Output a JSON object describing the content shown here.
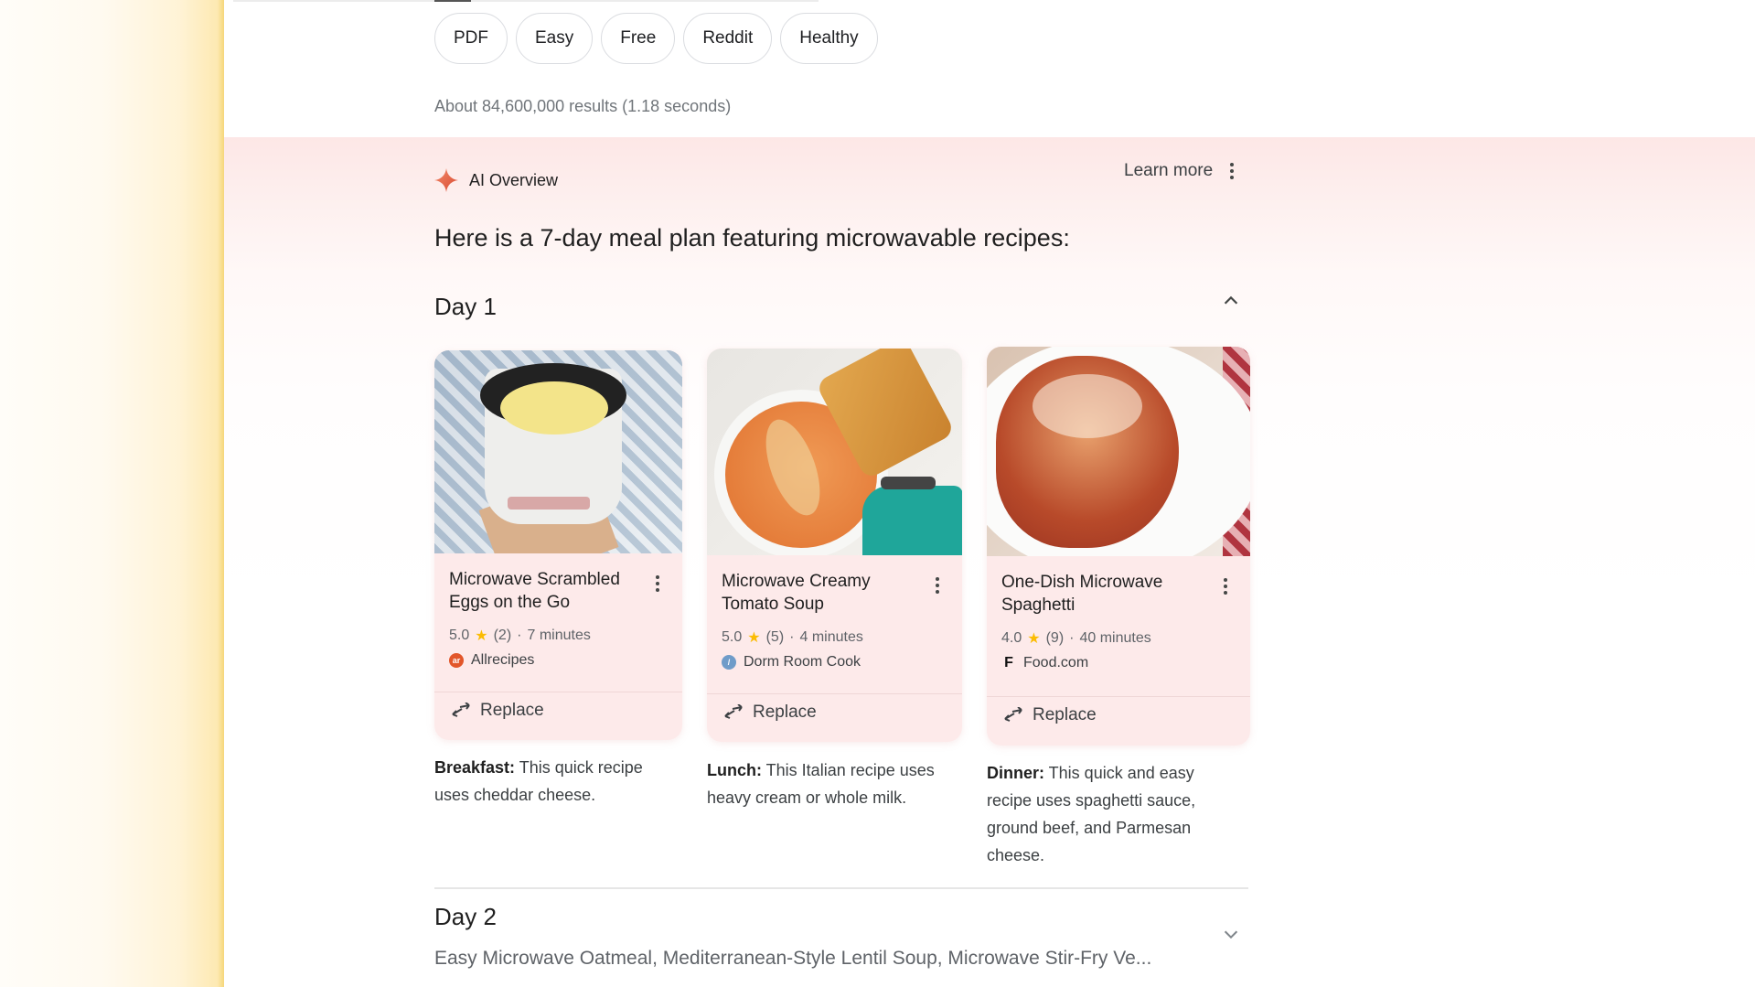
{
  "filter_chips": [
    "PDF",
    "Easy",
    "Free",
    "Reddit",
    "Healthy"
  ],
  "results_stats": "About 84,600,000 results (1.18 seconds)",
  "ai_overview": {
    "title": "AI Overview",
    "learn_more": "Learn more",
    "intro": "Here is a 7-day meal plan featuring microwavable recipes:",
    "accent_color": "#e8664f"
  },
  "days": [
    {
      "title": "Day 1",
      "expanded": true,
      "recipes": [
        {
          "title": "Microwave Scrambled Eggs on the Go",
          "rating": "5.0",
          "reviews": "(2)",
          "time": "7 minutes",
          "source": "Allrecipes",
          "source_icon": "allrecipes-logo",
          "action": "Replace"
        },
        {
          "title": "Microwave Creamy Tomato Soup",
          "rating": "5.0",
          "reviews": "(5)",
          "time": "4 minutes",
          "source": "Dorm Room Cook",
          "source_icon": "dorm-room-cook-logo",
          "action": "Replace"
        },
        {
          "title": "One-Dish Microwave Spaghetti",
          "rating": "4.0",
          "reviews": "(9)",
          "time": "40 minutes",
          "source": "Food.com",
          "source_icon": "food-com-logo",
          "action": "Replace"
        }
      ],
      "meals": [
        {
          "label": "Breakfast:",
          "text": " This quick recipe uses cheddar cheese."
        },
        {
          "label": "Lunch:",
          "text": " This Italian recipe uses heavy cream or whole milk."
        },
        {
          "label": "Dinner:",
          "text": " This quick and easy recipe uses spaghetti sauce, ground beef, and Parmesan cheese."
        }
      ]
    },
    {
      "title": "Day 2",
      "expanded": false,
      "summary": "Easy Microwave Oatmeal, Mediterranean-Style Lentil Soup, Microwave Stir-Fry Ve..."
    }
  ],
  "separator": "·",
  "star": "★"
}
